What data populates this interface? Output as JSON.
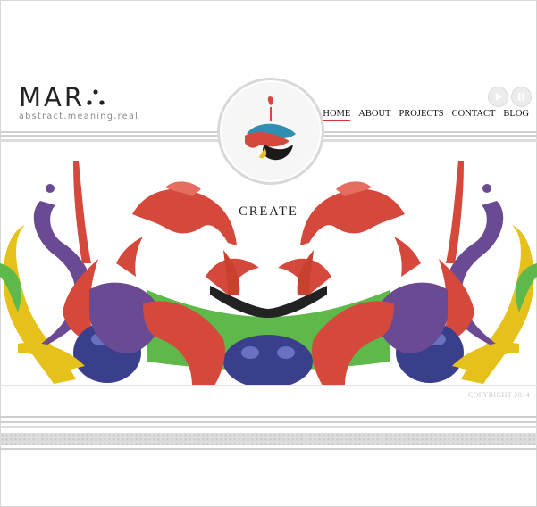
{
  "logo": {
    "mark": "MAR",
    "tagline": "abstract.meaning.real"
  },
  "nav": {
    "items": [
      "HOME",
      "ABOUT",
      "PROJECTS",
      "CONTACT",
      "BLOG"
    ]
  },
  "media": {
    "play": "play-icon",
    "pause": "pause-icon"
  },
  "hero": {
    "title": "CREATE"
  },
  "footer": {
    "copyright": "COPYRIGHT 2014"
  },
  "colors": {
    "accent": "#d23a3a",
    "green": "#5fb84a",
    "purple": "#6a4a92",
    "yellow": "#e9c21a",
    "navy": "#3a3f8c"
  }
}
